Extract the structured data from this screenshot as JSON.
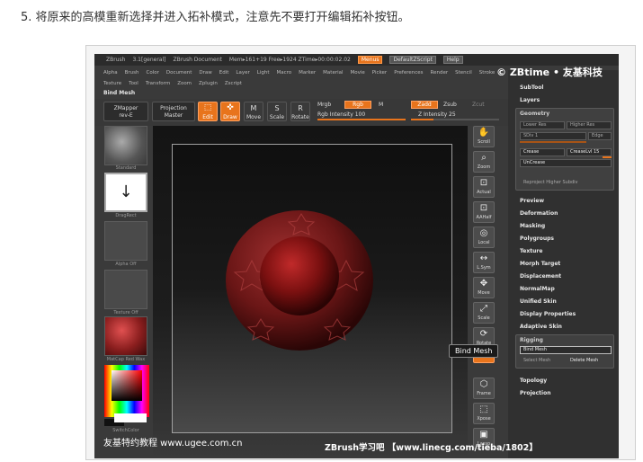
{
  "caption": "5. 将原来的高模重新选择并进入拓补模式，注意先不要打开编辑拓补按钮。",
  "titlebar": {
    "app": "ZBrush",
    "version": "3.1[general]",
    "doc": "ZBrush Document",
    "mem": "Mem▸161+19 Free▸1924 ZTime▸00:00:02.02",
    "menus": "Menus",
    "script": "DefaultZScript",
    "help": "Help"
  },
  "menubar": [
    "Alpha",
    "Brush",
    "Color",
    "Document",
    "Draw",
    "Edit",
    "Layer",
    "Light",
    "Macro",
    "Marker",
    "Material",
    "Movie",
    "Picker",
    "Preferences",
    "Render",
    "Stencil",
    "Stroke"
  ],
  "menubar2": [
    "Texture",
    "Tool",
    "Transform",
    "Zoom",
    "Zplugin",
    "Zscript"
  ],
  "bind_title": "Bind Mesh",
  "toprow": {
    "zmapper": "ZMapper",
    "zmapper2": "rev-E",
    "projection": "Projection",
    "projection2": "Master",
    "edit": "Edit",
    "draw": "Draw",
    "move": "Move",
    "scale": "Scale",
    "rotate": "Rotate",
    "mrgb": "Mrgb",
    "rgb": "Rgb",
    "m": "M",
    "rgb_intensity": "Rgb Intensity 100",
    "zadd": "Zadd",
    "zsub": "Zsub",
    "zcut": "Zcut",
    "z_intensity": "Z Intensity 25"
  },
  "leftcol": {
    "standard": "Standard",
    "dragrect": "DragRect",
    "alpha": "Alpha  Off",
    "texture": "Texture  Off",
    "matcap": "MatCap Red Wax",
    "switchcolor": "SwitchColor"
  },
  "rightshelf": [
    {
      "name": "scroll",
      "label": "Scroll"
    },
    {
      "name": "zoom",
      "label": "Zoom"
    },
    {
      "name": "actual",
      "label": "Actual"
    },
    {
      "name": "aahalf",
      "label": "AAHalf"
    },
    {
      "name": "local",
      "label": "Local"
    },
    {
      "name": "lsym",
      "label": "L.Sym"
    },
    {
      "name": "move",
      "label": "Move"
    },
    {
      "name": "scale",
      "label": "Scale"
    },
    {
      "name": "rotate",
      "label": "Rotate"
    },
    {
      "name": "polyf",
      "label": "PolyF"
    },
    {
      "name": "frame",
      "label": "Frame"
    },
    {
      "name": "xpose",
      "label": "Xpose"
    },
    {
      "name": "lasso",
      "label": "Lasso"
    }
  ],
  "tray": {
    "subtool": "SubTool",
    "layers": "Layers",
    "geometry": "Geometry",
    "lower_res": "Lower Res",
    "higher_res": "Higher Res",
    "sdiv": "SDiv 1",
    "edge": "Edge",
    "crease": "Crease",
    "creaselvl": "CreaseLvl 15",
    "uncrease": "UnCrease",
    "reproject": "Reproject Higher Subdiv",
    "preview": "Preview",
    "deformation": "Deformation",
    "masking": "Masking",
    "polygroups": "Polygroups",
    "texture": "Texture",
    "morph_target": "Morph Target",
    "displacement": "Displacement",
    "normalmap": "NormalMap",
    "unified_skin": "Unified Skin",
    "display_properties": "Display Properties",
    "adaptive_skin": "Adaptive Skin",
    "rigging": "Rigging",
    "bind_mesh": "Bind Mesh",
    "select_mesh": "Select Mesh",
    "delete_mesh": "Delete Mesh",
    "topology": "Topology",
    "projection": "Projection"
  },
  "tooltip": "Bind Mesh",
  "watermarks": {
    "top": "© ZBtime • 友基科技",
    "bottom_left": "友基特约教程  www.ugee.com.cn",
    "bottom_right": "ZBrush学习吧  【www.linecg.com/tieba/1802】"
  },
  "colors": {
    "accent": "#e8741c",
    "sphere": "#8a1e1e"
  }
}
